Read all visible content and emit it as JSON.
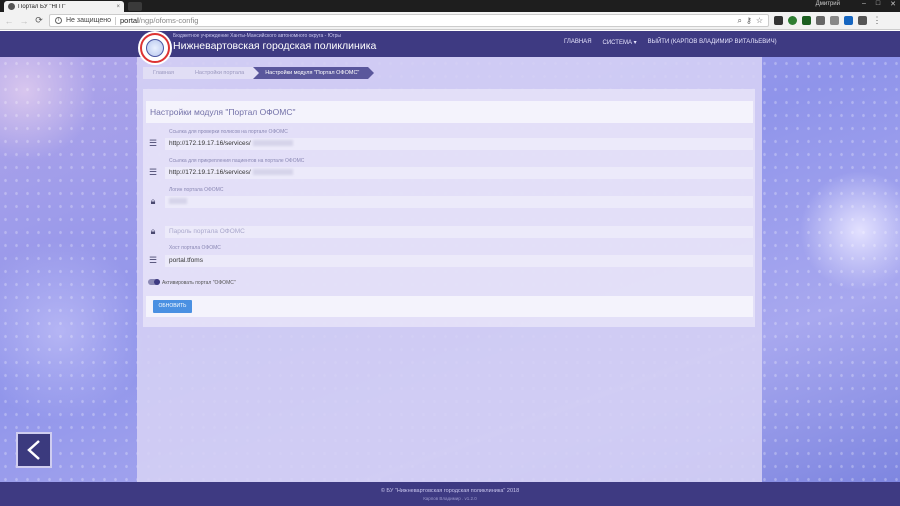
{
  "browser": {
    "tab_title": "Портал БУ \"НГП\"",
    "tab_close": "×",
    "profile": "Дмитрий",
    "window_controls": [
      "–",
      "□",
      "✕"
    ],
    "back": "←",
    "forward": "→",
    "reload": "⟳",
    "security_text": "Не защищено",
    "url_host": "portal",
    "url_path": "/ngp/ofoms-config",
    "icons": [
      "search-icon",
      "key-icon",
      "star-icon"
    ],
    "extension_colors": [
      "#333333",
      "#2e7d32",
      "#1b5e20",
      "#666666",
      "#888888",
      "#1565c0",
      "#555555"
    ]
  },
  "site": {
    "org_subtitle": "Бюджетное учреждение Ханты-Мансийского автономного округа - Югры",
    "org_title": "Нижневартовская городская поликлиника",
    "nav": {
      "home": "ГЛАВНАЯ",
      "system": "СИСТЕМА ▾",
      "logout": "ВЫЙТИ (КАРПОВ ВЛАДИМИР ВИТАЛЬЕВИЧ)"
    },
    "brand_color": "#3e3a82"
  },
  "breadcrumbs": [
    "Главная",
    "Настройки портала",
    "Настройки модуля \"Портал ОФОМС\""
  ],
  "form": {
    "title": "Настройки модуля \"Портал ОФОМС\"",
    "fields": [
      {
        "label": "Ссылка для проверки полисов на портале ОФОМС",
        "value": "http://172.19.17.16/services/",
        "icon": "server-icon"
      },
      {
        "label": "Ссылка для прикрепления пациентов на портале ОФОМС",
        "value": "http://172.19.17.16/services/",
        "icon": "server-icon"
      },
      {
        "label": "Логин портала ОФОМС",
        "value": "",
        "icon": "lock-icon"
      },
      {
        "placeholder": "Пароль портала ОФОМС",
        "icon": "lock-icon"
      },
      {
        "label": "Хост портала ОФОМС",
        "value": "portal.tfoms",
        "icon": "server-icon"
      }
    ],
    "toggle_label": "Активировать портал \"ОФОМС\"",
    "submit": "ОБНОВИТЬ",
    "accent_color": "#4a90e2"
  },
  "footer": {
    "copyright": "© БУ \"Нижневартовская городская поликлиника\" 2018",
    "author": "Карпов Владимир . v1.2.0"
  }
}
